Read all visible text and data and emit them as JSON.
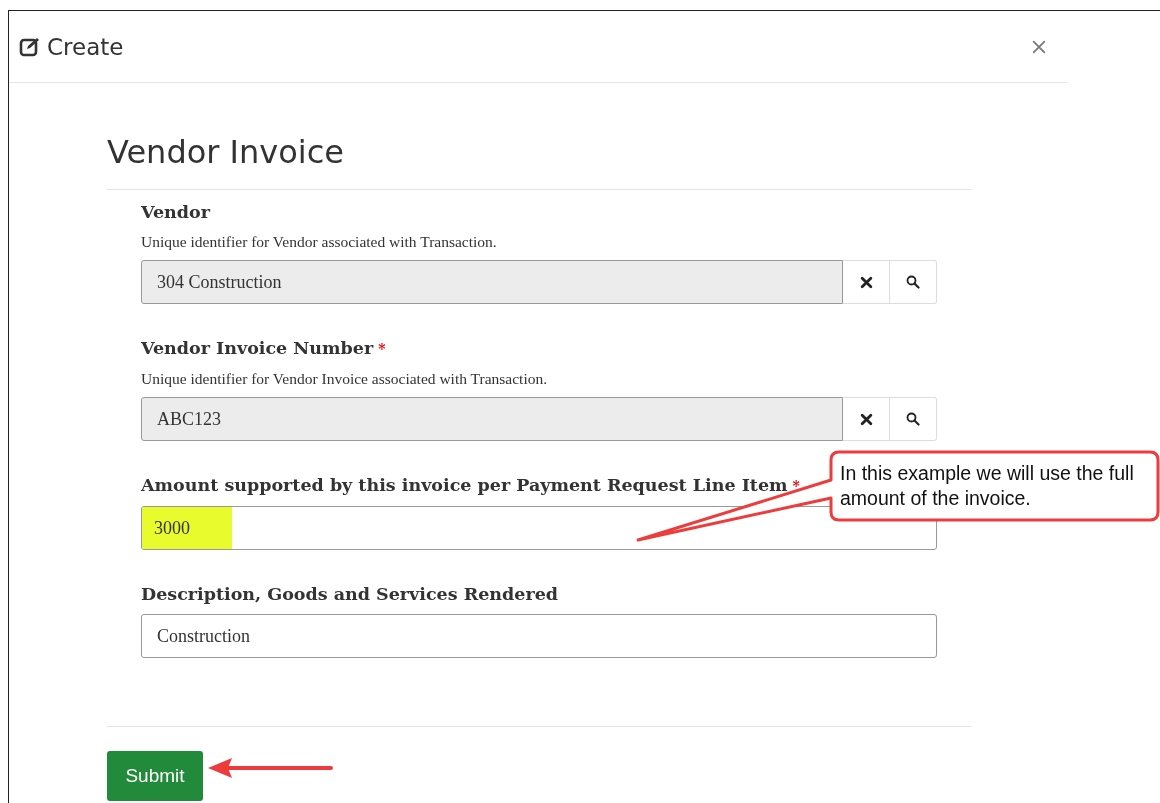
{
  "dialog": {
    "title": "Create"
  },
  "form": {
    "title": "Vendor Invoice",
    "fields": [
      {
        "kind": "lookup",
        "label": "Vendor",
        "description": "Unique identifier for Vendor associated with Transaction.",
        "value": "304 Construction",
        "highlighted": false
      },
      {
        "kind": "lookup",
        "label": "Vendor Invoice Number",
        "required_mark": "*",
        "description": "Unique identifier for Vendor Invoice associated with Transaction.",
        "value": "ABC123",
        "highlighted": false
      },
      {
        "kind": "text",
        "label": "Amount supported by this invoice per Payment Request Line Item",
        "required_mark": "*",
        "value": "3000",
        "highlighted": true
      },
      {
        "kind": "text",
        "label": "Description, Goods and Services Rendered",
        "value": "Construction",
        "highlighted": false
      }
    ],
    "submit": "Submit"
  },
  "annotations": [
    {
      "kind": "callout",
      "text": "In this example we will use the full amount of the invoice."
    },
    {
      "kind": "arrow"
    }
  ]
}
